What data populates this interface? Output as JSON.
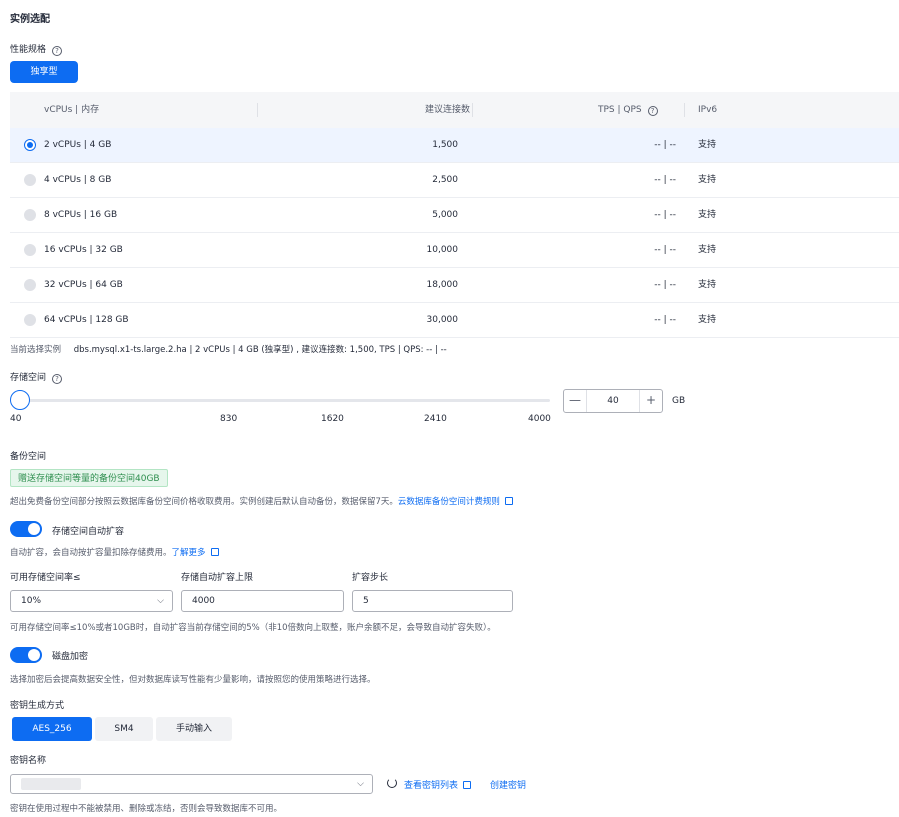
{
  "section_title": "实例选配",
  "performance": {
    "label": "性能规格",
    "help": "?",
    "type_button": "独享型"
  },
  "table": {
    "headers": [
      "vCPUs | 内存",
      "建议连接数",
      "TPS | QPS",
      "IPv6"
    ],
    "rows": [
      {
        "spec": "2 vCPUs | 4 GB",
        "conn": "1,500",
        "tps": "-- | --",
        "ipv6": "支持",
        "selected": true
      },
      {
        "spec": "4 vCPUs | 8 GB",
        "conn": "2,500",
        "tps": "-- | --",
        "ipv6": "支持",
        "selected": false
      },
      {
        "spec": "8 vCPUs | 16 GB",
        "conn": "5,000",
        "tps": "-- | --",
        "ipv6": "支持",
        "selected": false
      },
      {
        "spec": "16 vCPUs | 32 GB",
        "conn": "10,000",
        "tps": "-- | --",
        "ipv6": "支持",
        "selected": false
      },
      {
        "spec": "32 vCPUs | 64 GB",
        "conn": "18,000",
        "tps": "-- | --",
        "ipv6": "支持",
        "selected": false
      },
      {
        "spec": "64 vCPUs | 128 GB",
        "conn": "30,000",
        "tps": "-- | --",
        "ipv6": "支持",
        "selected": false
      }
    ]
  },
  "current_selection": {
    "label": "当前选择实例",
    "value": "dbs.mysql.x1-ts.large.2.ha | 2 vCPUs | 4 GB (独享型) , 建议连接数: 1,500, TPS | QPS: -- | --"
  },
  "storage": {
    "label": "存储空间",
    "ticks": [
      "40",
      "830",
      "1620",
      "2410",
      "4000"
    ],
    "value": "40",
    "unit": "GB",
    "minus": "—",
    "plus": "+"
  },
  "backup": {
    "label": "备份空间",
    "tag": "赠送存储空间等量的备份空间40GB",
    "desc": "超出免费备份空间部分按照云数据库备份空间价格收取费用。实例创建后默认自动备份，数据保留7天。",
    "link": "云数据库备份空间计费规则"
  },
  "autoscale": {
    "label": "存储空间自动扩容",
    "desc": "自动扩容，会自动按扩容量扣除存储费用。",
    "link": "了解更多",
    "field1_label": "可用存储空间率≤",
    "field1_value": "10%",
    "field2_label": "存储自动扩容上限",
    "field2_value": "4000",
    "field3_label": "扩容步长",
    "field3_value": "5",
    "note": "可用存储空间率≤10%或者10GB时，自动扩容当前存储空间的5%（非10倍数向上取整，账户余额不足，会导致自动扩容失败）。"
  },
  "encryption": {
    "label": "磁盘加密",
    "desc": "选择加密后会提高数据安全性，但对数据库读写性能有少量影响，请按照您的使用策略进行选择。"
  },
  "key_method": {
    "label": "密钥生成方式",
    "options": [
      "AES_256",
      "SM4",
      "手动输入"
    ]
  },
  "key_name": {
    "label": "密钥名称",
    "view_link": "查看密钥列表",
    "create_link": "创建密钥",
    "note": "密钥在使用过程中不能被禁用、删除或冻结，否则会导致数据库不可用。"
  },
  "colors": {
    "primary": "#0d6cf2",
    "selected_row": "#eef4ff",
    "tag_green": "#e6f6ec"
  }
}
